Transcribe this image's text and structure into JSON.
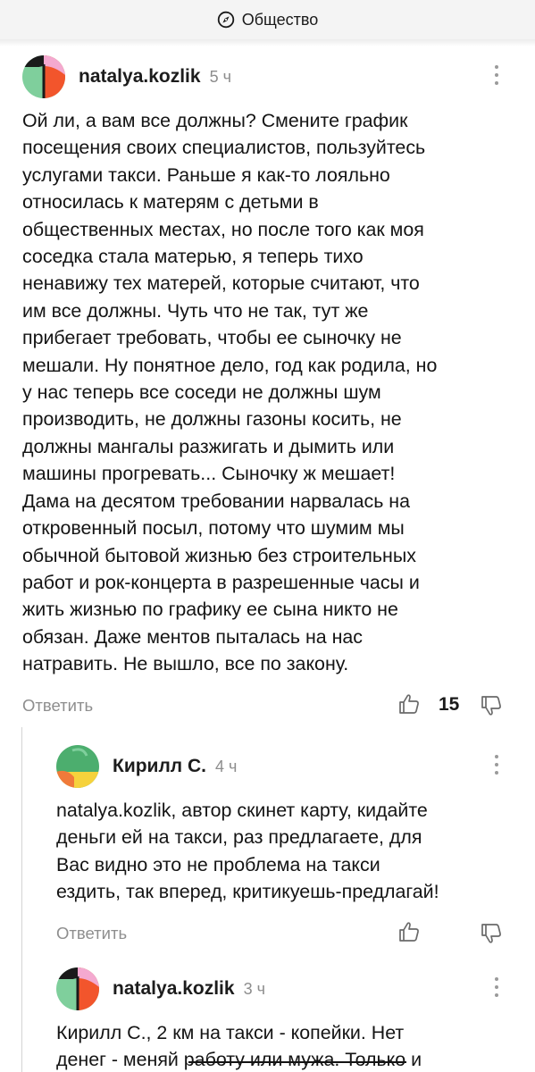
{
  "header": {
    "title": "Общество",
    "icon": "compass-icon"
  },
  "comments": [
    {
      "author": "natalya.kozlik",
      "time": "5 ч",
      "lines": [
        "Ой ли, а вам все должны? Смените график",
        "посещения своих специалистов, пользуйтесь",
        "услугами такси. Раньше я как-то лояльно",
        "относилась к матерям с детьми в",
        "общественных местах, но после того как моя",
        "соседка стала матерью, я теперь тихо",
        "ненавижу тех матерей, которые считают, что",
        "им все должны. Чуть что не так, тут же",
        "прибегает требовать, чтобы ее сыночку не",
        "мешали. Ну понятное дело, год как родила, но",
        "у нас теперь все соседи не должны шум",
        "производить, не должны газоны косить, не",
        "должны мангалы разжигать и дымить или",
        "машины прогревать... Сыночку ж мешает!",
        "Дама на десятом требовании нарвалась на",
        "откровенный посыл, потому что шумим мы",
        "обычной бытовой жизнью без строительных",
        "работ и рок-концерта в разрешенные часы и",
        "жить жизнью по графику ее сына никто не",
        "обязан. Даже ментов пыталась на нас",
        "натравить. Не вышло, все по закону."
      ],
      "reply_label": "Ответить",
      "score": "15"
    },
    {
      "author": "Кирилл С.",
      "time": "4 ч",
      "lines": [
        "natalya.kozlik, автор скинет карту, кидайте",
        "деньги ей на такси, раз предлагаете, для",
        "Вас видно это не проблема на такси",
        "ездить, так вперед, критикуешь-предлагай!"
      ],
      "reply_label": "Ответить",
      "score": ""
    },
    {
      "author": "natalya.kozlik",
      "time": "3 ч",
      "lines": [
        "Кирилл С., 2 км на такси - копейки. Нет",
        "денег - меняй работу или мужа. Только и"
      ]
    }
  ],
  "colors": {
    "avatar_pink": "#f4a9d0",
    "avatar_orange": "#f2552c",
    "avatar_green": "#7fcf9c",
    "avatar_dark": "#1a1a1a",
    "avatar2_green": "#4cae6e",
    "avatar2_yellow": "#f6d23c",
    "avatar2_orange": "#f07a3a"
  }
}
